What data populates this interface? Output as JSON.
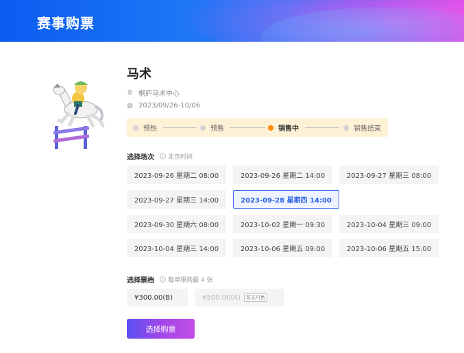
{
  "header": {
    "title": "赛事购票"
  },
  "event": {
    "name": "马术",
    "venue": "桐庐马术中心",
    "dates": "2023/09/26-10/06"
  },
  "progress": {
    "steps": [
      {
        "label": "预热",
        "active": false
      },
      {
        "label": "预售",
        "active": false
      },
      {
        "label": "销售中",
        "active": true
      },
      {
        "label": "销售结束",
        "active": false
      }
    ]
  },
  "session": {
    "label": "选择场次",
    "hint": "北京时间",
    "slots": [
      "2023-09-26 星期二 08:00",
      "2023-09-26 星期二 14:00",
      "2023-09-27 星期三 08:00",
      "2023-09-27 星期三 14:00",
      "2023-09-28 星期四 14:00",
      "2023-09-30 星期六 08:00",
      "2023-10-02 星期一 09:30",
      "2023-10-04 星期三 09:00",
      "2023-10-04 星期三 14:00",
      "2023-10-06 星期五 09:00",
      "2023-10-06 星期五 15:00"
    ],
    "selected": "2023-09-28 星期四 14:00"
  },
  "tickets": {
    "label": "选择票档",
    "hint": "每单限购最 4 张",
    "tiers": [
      {
        "price": "¥300.00(B)",
        "available": true
      },
      {
        "price": "¥500.00(A)",
        "available": false,
        "badge": "暂无可售"
      }
    ]
  },
  "actions": {
    "buy_label": "选择购票"
  },
  "colors": {
    "accent_blue": "#3c6df0",
    "active_step": "#ff8a00",
    "progress_bg": "#fdf1d6"
  }
}
